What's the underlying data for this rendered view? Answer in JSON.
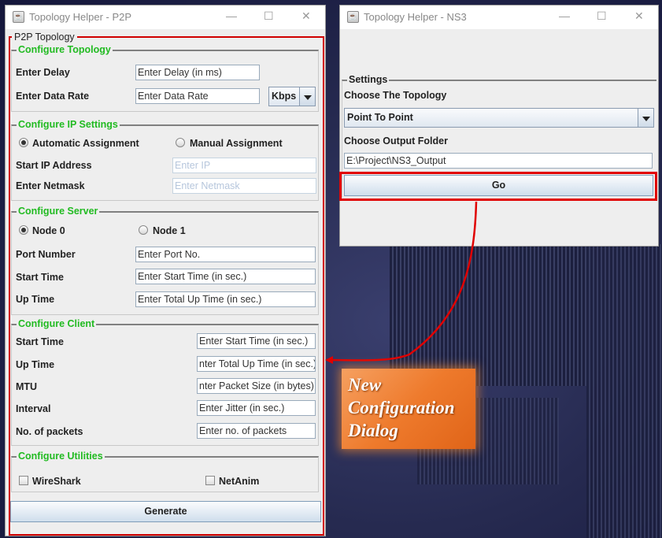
{
  "p2p_window": {
    "title": "Topology Helper - P2P",
    "outer_legend": "P2P Topology",
    "topology": {
      "legend": "Configure Topology",
      "delay_label": "Enter Delay",
      "delay_placeholder": "Enter Delay (in ms)",
      "rate_label": "Enter Data Rate",
      "rate_placeholder": "Enter Data Rate",
      "rate_unit": "Kbps"
    },
    "ip": {
      "legend": "Configure IP Settings",
      "auto_label": "Automatic Assignment",
      "manual_label": "Manual Assignment",
      "selected": "Automatic Assignment",
      "start_ip_label": "Start IP Address",
      "start_ip_placeholder": "Enter IP",
      "netmask_label": "Enter Netmask",
      "netmask_placeholder": "Enter Netmask"
    },
    "server": {
      "legend": "Configure Server",
      "node0_label": "Node 0",
      "node1_label": "Node 1",
      "selected": "Node 0",
      "port_label": "Port Number",
      "port_placeholder": "Enter Port No.",
      "start_label": "Start Time",
      "start_placeholder": "Enter Start Time (in sec.)",
      "up_label": "Up Time",
      "up_placeholder": "Enter Total Up Time (in sec.)"
    },
    "client": {
      "legend": "Configure Client",
      "start_label": "Start Time",
      "start_placeholder": "Enter Start Time (in sec.)",
      "up_label": "Up Time",
      "up_placeholder": "nter Total Up Time (in sec.)",
      "mtu_label": "MTU",
      "mtu_placeholder": "nter Packet Size (in bytes)",
      "interval_label": "Interval",
      "interval_placeholder": "Enter Jitter (in sec.)",
      "packets_label": "No. of packets",
      "packets_placeholder": "Enter no. of packets"
    },
    "utilities": {
      "legend": "Configure Utilities",
      "wireshark_label": "WireShark",
      "netanim_label": "NetAnim",
      "wireshark_checked": false,
      "netanim_checked": false
    },
    "generate_label": "Generate"
  },
  "ns3_window": {
    "title": "Topology Helper - NS3",
    "legend": "Settings",
    "topology_label": "Choose The Topology",
    "topology_value": "Point To Point",
    "output_label": "Choose Output Folder",
    "output_value": "E:\\Project\\NS3_Output",
    "go_label": "Go"
  },
  "callout": {
    "line1": "New",
    "line2": "Configuration",
    "line3": "Dialog"
  },
  "colors": {
    "highlight": "#e00000",
    "section_title": "#22bb22",
    "callout": "#ee7a2c"
  }
}
